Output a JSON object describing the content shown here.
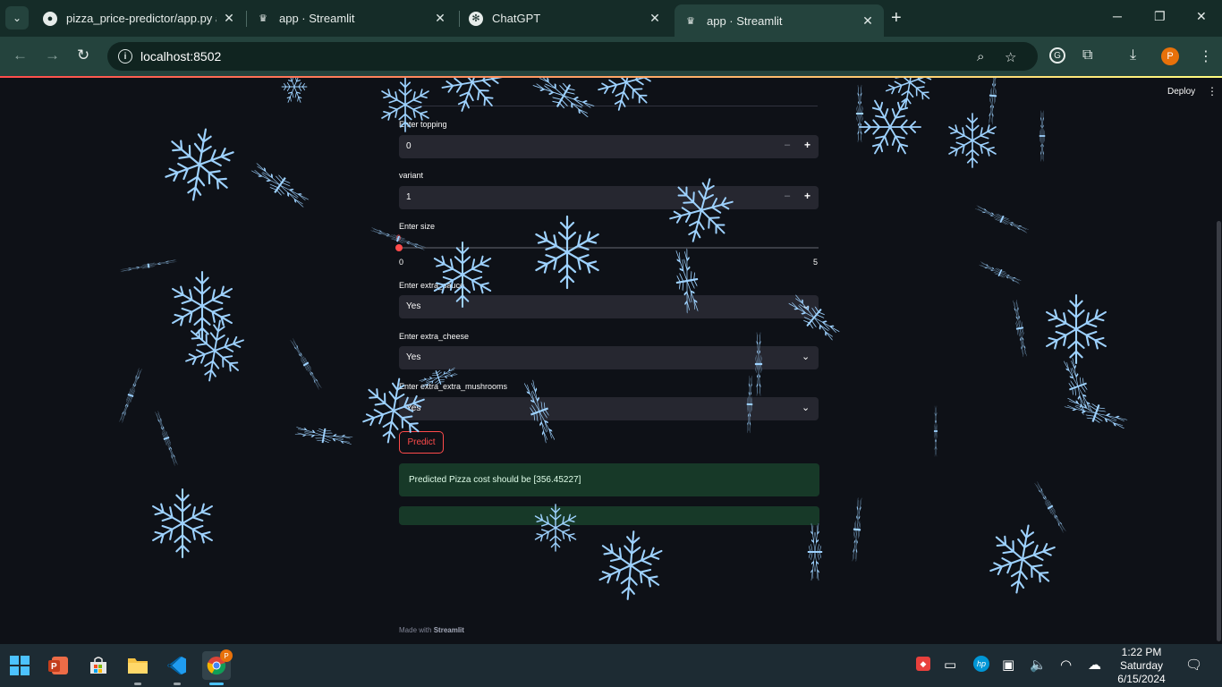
{
  "browser": {
    "tabs": [
      {
        "title": "pizza_price-predictor/app.py at",
        "icon": "github-icon"
      },
      {
        "title": "app · Streamlit",
        "icon": "streamlit-icon"
      },
      {
        "title": "ChatGPT",
        "icon": "chatgpt-icon"
      },
      {
        "title": "app · Streamlit",
        "icon": "streamlit-icon",
        "active": true
      }
    ],
    "url": "localhost:8502",
    "profile_initial": "P"
  },
  "app": {
    "header": {
      "deploy_label": "Deploy"
    },
    "topping": {
      "label": "Enter topping",
      "value": "0",
      "minus": "–",
      "plus": "+"
    },
    "variant": {
      "label": "variant",
      "value": "1",
      "minus": "–",
      "plus": "+"
    },
    "size": {
      "label": "Enter size",
      "value": "0",
      "min": "0",
      "max": "5",
      "fraction": 0.0
    },
    "extra_sauce": {
      "label": "Enter extra_sauce",
      "value": "Yes"
    },
    "extra_cheese": {
      "label": "Enter extra_cheese",
      "value": "Yes"
    },
    "extra_mushrooms": {
      "label": "Enter extra_extra_mushrooms",
      "value": "Yes"
    },
    "predict_label": "Predict",
    "result_text": "Predicted Pizza cost should be [356.45227]",
    "footer": {
      "prefix": "Made with",
      "brand": "Streamlit"
    },
    "accent_color": "#ff4b4b",
    "snowflake_color": "#9ed2ff"
  },
  "taskbar": {
    "apps": [
      "windows-start-icon",
      "powerpoint-icon",
      "microsoft-store-icon",
      "file-explorer-icon",
      "vscode-icon",
      "chrome-icon"
    ],
    "time": "1:22 PM",
    "day": "Saturday",
    "date": "6/15/2024"
  }
}
